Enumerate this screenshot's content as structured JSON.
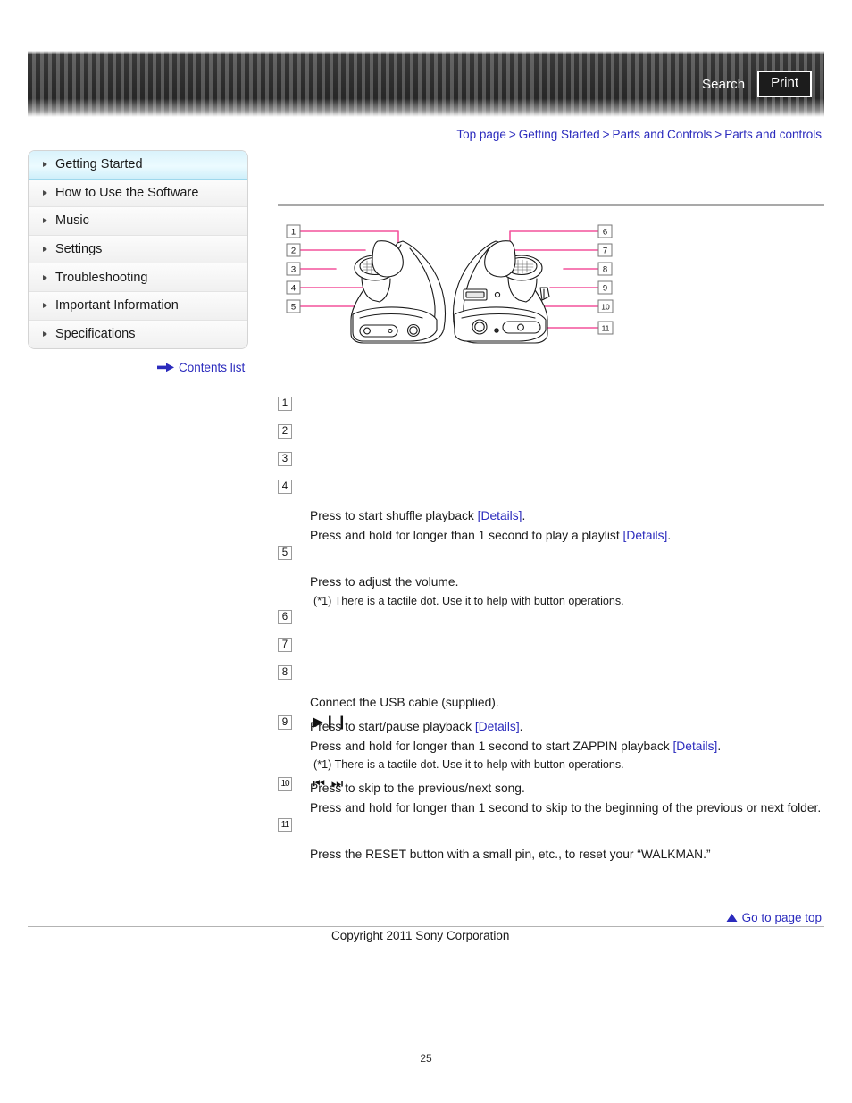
{
  "header": {
    "search_label": "Search",
    "print_label": "Print",
    "search_icon": "search-icon",
    "print_icon": "print-icon"
  },
  "breadcrumb": {
    "separator": ">",
    "items": [
      {
        "label": "Top page"
      },
      {
        "label": "Getting Started"
      },
      {
        "label": "Parts and Controls"
      },
      {
        "label": "Parts and controls"
      }
    ]
  },
  "sidebar": {
    "bullet_icon": "triangle-right-icon",
    "items": [
      {
        "label": "Getting Started",
        "active": true
      },
      {
        "label": "How to Use the Software",
        "active": false
      },
      {
        "label": "Music",
        "active": false
      },
      {
        "label": "Settings",
        "active": false
      },
      {
        "label": "Troubleshooting",
        "active": false
      },
      {
        "label": "Important Information",
        "active": false
      },
      {
        "label": "Specifications",
        "active": false
      }
    ]
  },
  "contents_list": {
    "label": "Contents list",
    "icon": "arrow-right-icon"
  },
  "diagram": {
    "name": "walkman-parts-and-controls-diagram",
    "alt": "Line drawing of the WALKMAN wearable player, left and right views, with numbered callouts 1 through 11",
    "callout_numbers": [
      "1",
      "2",
      "3",
      "4",
      "5",
      "6",
      "7",
      "8",
      "9",
      "10",
      "11"
    ],
    "callout_color": "#f4529c"
  },
  "parts": [
    {
      "num": "1",
      "glyph": "",
      "lines": []
    },
    {
      "num": "2",
      "glyph": "",
      "lines": []
    },
    {
      "num": "3",
      "glyph": "",
      "lines": []
    },
    {
      "num": "4",
      "glyph": "",
      "lines": [
        {
          "pre": "Press to start shuffle playback ",
          "link": "[Details]",
          "post": "."
        },
        {
          "pre": "Press and hold for longer than 1 second to play a playlist ",
          "link": "[Details]",
          "post": "."
        }
      ]
    },
    {
      "num": "5",
      "glyph": "",
      "lines": [
        {
          "pre": "Press to adjust the volume.",
          "link": "",
          "post": ""
        }
      ],
      "note": "(*1) There is a tactile dot. Use it to help with button operations."
    },
    {
      "num": "6",
      "glyph": "",
      "lines": []
    },
    {
      "num": "7",
      "glyph": "",
      "lines": []
    },
    {
      "num": "8",
      "glyph": "",
      "lines": [
        {
          "pre": "Connect the USB cable (supplied).",
          "link": "",
          "post": ""
        }
      ]
    },
    {
      "num": "9",
      "glyph": "▶❙❙",
      "glyph_name": "play-pause-icon",
      "lines": [
        {
          "pre": "Press to start/pause playback ",
          "link": "[Details]",
          "post": "."
        },
        {
          "pre": "Press and hold for longer than 1 second to start ZAPPIN playback ",
          "link": "[Details]",
          "post": "."
        }
      ],
      "note": "(*1) There is a tactile dot. Use it to help with button operations."
    },
    {
      "num": "10",
      "glyph": "⏮ ⏭",
      "glyph_name": "previous-next-track-icon",
      "lines": [
        {
          "pre": "Press to skip to the previous/next song.",
          "link": "",
          "post": ""
        },
        {
          "pre": "Press and hold for longer than 1 second to skip to the beginning of the previous or next folder.",
          "link": "",
          "post": ""
        }
      ]
    },
    {
      "num": "11",
      "glyph": "",
      "lines": [
        {
          "pre": "Press the RESET button with a small pin, etc., to reset your “WALKMAN.”",
          "link": "",
          "post": ""
        }
      ]
    }
  ],
  "footer": {
    "goto_top_label": "Go to page top",
    "goto_top_icon": "triangle-up-icon",
    "copyright": "Copyright 2011 Sony Corporation",
    "page_number": "25"
  },
  "colors": {
    "link": "#2b2bbd",
    "callout": "#f4529c",
    "header_dark": "#2f2f2f",
    "active_sidebar": "#d9f2fb"
  }
}
